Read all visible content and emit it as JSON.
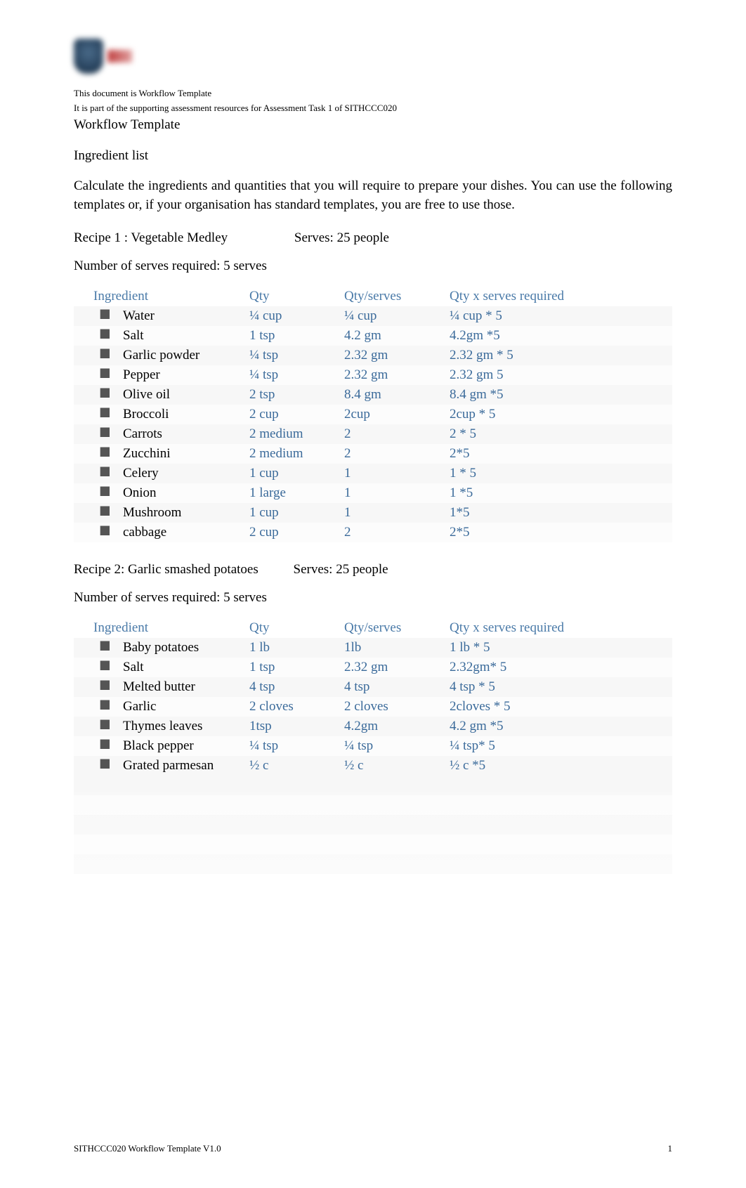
{
  "header": {
    "line1": "This document is Workflow Template",
    "line2": "It is part of the supporting assessment resources for Assessment Task 1 of SITHCCC020"
  },
  "title": "Workflow Template",
  "subtitle": "Ingredient list",
  "intro": "Calculate the ingredients and quantities that you will require to prepare your dishes. You can use the following templates or, if your organisation has standard templates, you are free to use those.",
  "table_headers": {
    "ingredient": "Ingredient",
    "qty": "Qty",
    "qty_serves": "Qty/serves",
    "qty_required": "Qty x serves required"
  },
  "recipe1": {
    "label": "Recipe 1 : Vegetable Medley",
    "serves": "Serves: 25 people",
    "serves_required": "Number of serves required: 5 serves",
    "rows": [
      {
        "ingredient": "Water",
        "qty": "¼ cup",
        "qty_serves": "¼ cup",
        "qty_required": "¼ cup * 5"
      },
      {
        "ingredient": "Salt",
        "qty": "1 tsp",
        "qty_serves": "4.2 gm",
        "qty_required": "4.2gm *5"
      },
      {
        "ingredient": "Garlic powder",
        "qty": "¼ tsp",
        "qty_serves": "2.32 gm",
        "qty_required": "2.32 gm * 5"
      },
      {
        "ingredient": "Pepper",
        "qty": "¼ tsp",
        "qty_serves": "2.32 gm",
        "qty_required": "2.32 gm 5"
      },
      {
        "ingredient": "Olive oil",
        "qty": "2 tsp",
        "qty_serves": "8.4 gm",
        "qty_required": "8.4 gm *5"
      },
      {
        "ingredient": "Broccoli",
        "qty": "2 cup",
        "qty_serves": "2cup",
        "qty_required": "2cup * 5"
      },
      {
        "ingredient": "Carrots",
        "qty": "2 medium",
        "qty_serves": "2",
        "qty_required": "2 * 5"
      },
      {
        "ingredient": "Zucchini",
        "qty": "2 medium",
        "qty_serves": "2",
        "qty_required": "2*5"
      },
      {
        "ingredient": "Celery",
        "qty": "1 cup",
        "qty_serves": "1",
        "qty_required": "1 * 5"
      },
      {
        "ingredient": "Onion",
        "qty": "1 large",
        "qty_serves": "1",
        "qty_required": "1 *5"
      },
      {
        "ingredient": "Mushroom",
        "qty": "1 cup",
        "qty_serves": "1",
        "qty_required": "1*5"
      },
      {
        "ingredient": "cabbage",
        "qty": "2 cup",
        "qty_serves": "2",
        "qty_required": "2*5"
      }
    ]
  },
  "recipe2": {
    "label": "Recipe 2: Garlic smashed potatoes",
    "serves": "Serves: 25 people",
    "serves_required": "Number of serves required: 5 serves",
    "rows": [
      {
        "ingredient": "Baby potatoes",
        "qty": "1 lb",
        "qty_serves": "1lb",
        "qty_required": "1 lb * 5"
      },
      {
        "ingredient": "Salt",
        "qty": "1 tsp",
        "qty_serves": "2.32 gm",
        "qty_required": "2.32gm* 5"
      },
      {
        "ingredient": "Melted butter",
        "qty": "4 tsp",
        "qty_serves": "4 tsp",
        "qty_required": "4 tsp * 5"
      },
      {
        "ingredient": "Garlic",
        "qty": "2 cloves",
        "qty_serves": "2 cloves",
        "qty_required": "2cloves * 5"
      },
      {
        "ingredient": "Thymes leaves",
        "qty": "1tsp",
        "qty_serves": "4.2gm",
        "qty_required": "4.2 gm *5"
      },
      {
        "ingredient": "Black pepper",
        "qty": "¼ tsp",
        "qty_serves": "¼ tsp",
        "qty_required": "¼ tsp* 5"
      },
      {
        "ingredient": "Grated parmesan",
        "qty": "½ c",
        "qty_serves": "½ c",
        "qty_required": "½ c *5"
      }
    ]
  },
  "footer": {
    "left": "SITHCCC020 Workflow Template V1.0",
    "right": "1"
  },
  "bullet": "⯀"
}
